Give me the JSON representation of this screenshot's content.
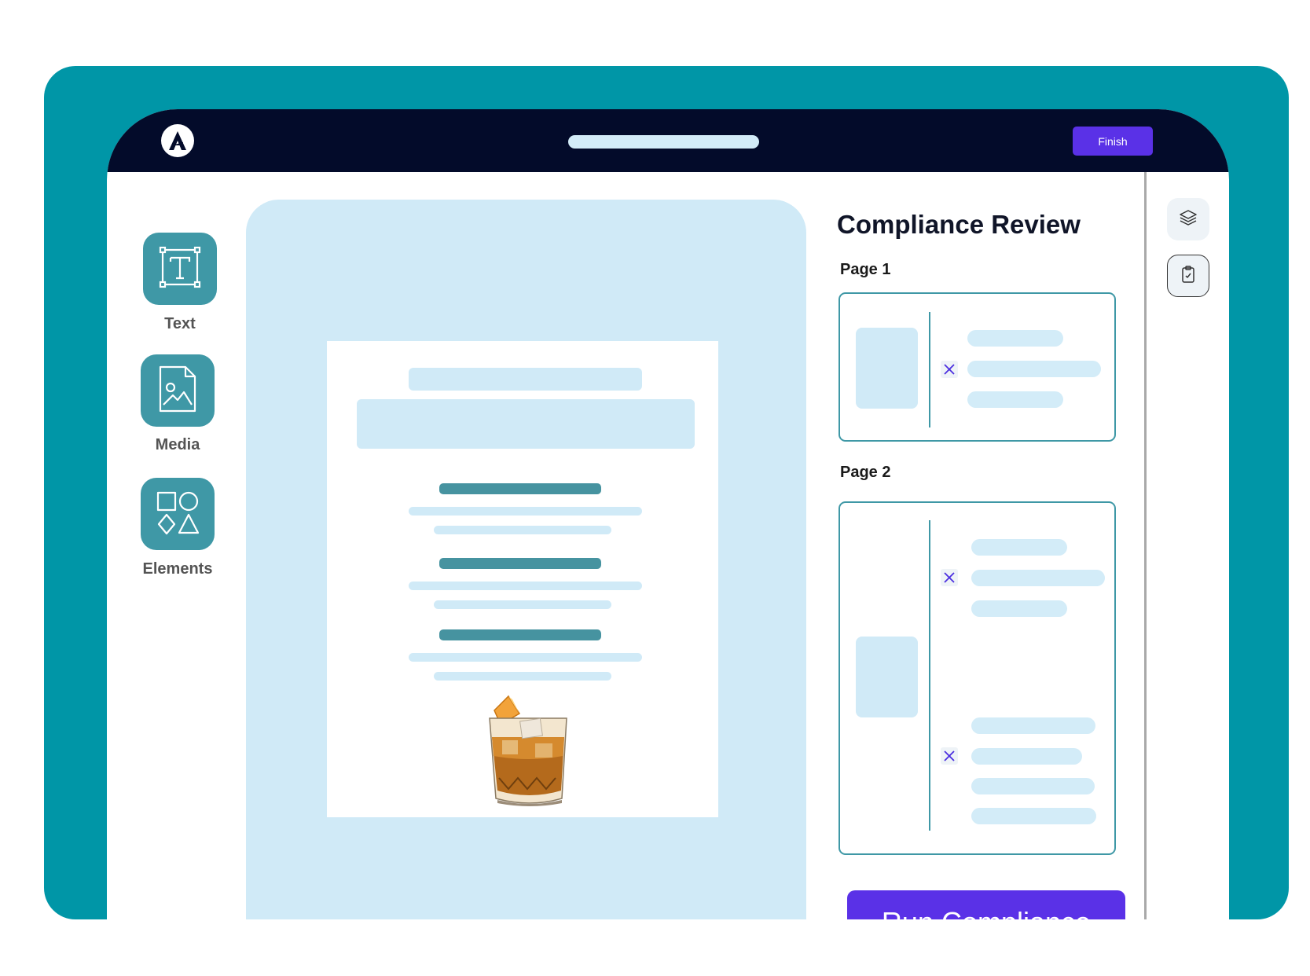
{
  "header": {
    "finish_label": "Finish"
  },
  "tools": [
    {
      "label": "Text",
      "icon": "text-tool-icon"
    },
    {
      "label": "Media",
      "icon": "media-tool-icon"
    },
    {
      "label": "Elements",
      "icon": "elements-tool-icon"
    }
  ],
  "review": {
    "title": "Compliance Review",
    "pages": [
      {
        "label": "Page 1"
      },
      {
        "label": "Page 2"
      }
    ],
    "run_label": "Run Compliance"
  },
  "side_toolbar": {
    "icons": [
      "layers-icon",
      "clipboard-check-icon"
    ]
  },
  "colors": {
    "frame": "#0096a7",
    "topbar": "#030b2a",
    "accent": "#5a31e7",
    "tool_tile": "#3f98a6",
    "placeholder": "#d0eaf7"
  }
}
